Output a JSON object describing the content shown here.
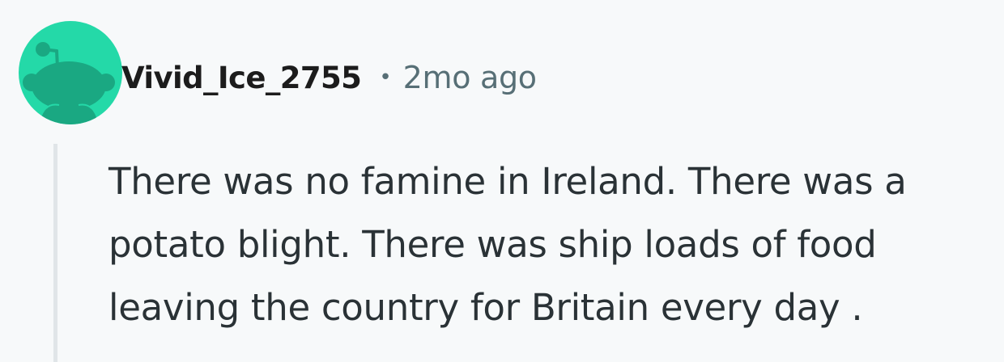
{
  "comment": {
    "author": "Vivid_Ice_2755",
    "separator": "•",
    "timestamp": "2mo ago",
    "text": "There was no famine in Ireland. There was a potato blight. There was ship loads of food leaving the country for Britain every day ."
  },
  "avatar": {
    "icon": "reddit-snoo-icon",
    "background_color": "#24d9a8",
    "figure_color": "#1aa882"
  },
  "colors": {
    "page_background": "#f7f9fa",
    "username": "#1c1c1c",
    "meta": "#576f76",
    "body_text": "#2a3236",
    "thread_line": "#e0e5e8"
  }
}
